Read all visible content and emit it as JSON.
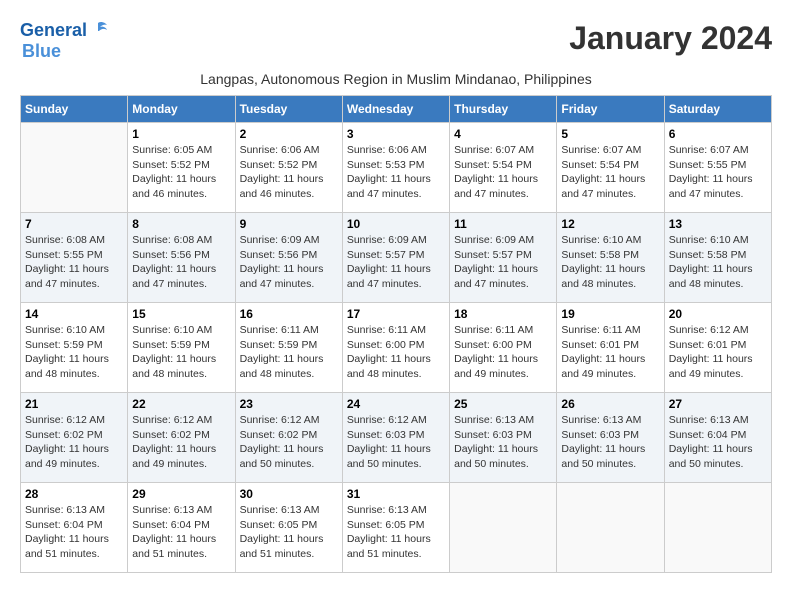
{
  "header": {
    "logo_line1": "General",
    "logo_line2": "Blue",
    "month_title": "January 2024",
    "subtitle": "Langpas, Autonomous Region in Muslim Mindanao, Philippines"
  },
  "days_of_week": [
    "Sunday",
    "Monday",
    "Tuesday",
    "Wednesday",
    "Thursday",
    "Friday",
    "Saturday"
  ],
  "weeks": [
    [
      {
        "day": "",
        "info": ""
      },
      {
        "day": "1",
        "info": "Sunrise: 6:05 AM\nSunset: 5:52 PM\nDaylight: 11 hours\nand 46 minutes."
      },
      {
        "day": "2",
        "info": "Sunrise: 6:06 AM\nSunset: 5:52 PM\nDaylight: 11 hours\nand 46 minutes."
      },
      {
        "day": "3",
        "info": "Sunrise: 6:06 AM\nSunset: 5:53 PM\nDaylight: 11 hours\nand 47 minutes."
      },
      {
        "day": "4",
        "info": "Sunrise: 6:07 AM\nSunset: 5:54 PM\nDaylight: 11 hours\nand 47 minutes."
      },
      {
        "day": "5",
        "info": "Sunrise: 6:07 AM\nSunset: 5:54 PM\nDaylight: 11 hours\nand 47 minutes."
      },
      {
        "day": "6",
        "info": "Sunrise: 6:07 AM\nSunset: 5:55 PM\nDaylight: 11 hours\nand 47 minutes."
      }
    ],
    [
      {
        "day": "7",
        "info": "Sunrise: 6:08 AM\nSunset: 5:55 PM\nDaylight: 11 hours\nand 47 minutes."
      },
      {
        "day": "8",
        "info": "Sunrise: 6:08 AM\nSunset: 5:56 PM\nDaylight: 11 hours\nand 47 minutes."
      },
      {
        "day": "9",
        "info": "Sunrise: 6:09 AM\nSunset: 5:56 PM\nDaylight: 11 hours\nand 47 minutes."
      },
      {
        "day": "10",
        "info": "Sunrise: 6:09 AM\nSunset: 5:57 PM\nDaylight: 11 hours\nand 47 minutes."
      },
      {
        "day": "11",
        "info": "Sunrise: 6:09 AM\nSunset: 5:57 PM\nDaylight: 11 hours\nand 47 minutes."
      },
      {
        "day": "12",
        "info": "Sunrise: 6:10 AM\nSunset: 5:58 PM\nDaylight: 11 hours\nand 48 minutes."
      },
      {
        "day": "13",
        "info": "Sunrise: 6:10 AM\nSunset: 5:58 PM\nDaylight: 11 hours\nand 48 minutes."
      }
    ],
    [
      {
        "day": "14",
        "info": "Sunrise: 6:10 AM\nSunset: 5:59 PM\nDaylight: 11 hours\nand 48 minutes."
      },
      {
        "day": "15",
        "info": "Sunrise: 6:10 AM\nSunset: 5:59 PM\nDaylight: 11 hours\nand 48 minutes."
      },
      {
        "day": "16",
        "info": "Sunrise: 6:11 AM\nSunset: 5:59 PM\nDaylight: 11 hours\nand 48 minutes."
      },
      {
        "day": "17",
        "info": "Sunrise: 6:11 AM\nSunset: 6:00 PM\nDaylight: 11 hours\nand 48 minutes."
      },
      {
        "day": "18",
        "info": "Sunrise: 6:11 AM\nSunset: 6:00 PM\nDaylight: 11 hours\nand 49 minutes."
      },
      {
        "day": "19",
        "info": "Sunrise: 6:11 AM\nSunset: 6:01 PM\nDaylight: 11 hours\nand 49 minutes."
      },
      {
        "day": "20",
        "info": "Sunrise: 6:12 AM\nSunset: 6:01 PM\nDaylight: 11 hours\nand 49 minutes."
      }
    ],
    [
      {
        "day": "21",
        "info": "Sunrise: 6:12 AM\nSunset: 6:02 PM\nDaylight: 11 hours\nand 49 minutes."
      },
      {
        "day": "22",
        "info": "Sunrise: 6:12 AM\nSunset: 6:02 PM\nDaylight: 11 hours\nand 49 minutes."
      },
      {
        "day": "23",
        "info": "Sunrise: 6:12 AM\nSunset: 6:02 PM\nDaylight: 11 hours\nand 50 minutes."
      },
      {
        "day": "24",
        "info": "Sunrise: 6:12 AM\nSunset: 6:03 PM\nDaylight: 11 hours\nand 50 minutes."
      },
      {
        "day": "25",
        "info": "Sunrise: 6:13 AM\nSunset: 6:03 PM\nDaylight: 11 hours\nand 50 minutes."
      },
      {
        "day": "26",
        "info": "Sunrise: 6:13 AM\nSunset: 6:03 PM\nDaylight: 11 hours\nand 50 minutes."
      },
      {
        "day": "27",
        "info": "Sunrise: 6:13 AM\nSunset: 6:04 PM\nDaylight: 11 hours\nand 50 minutes."
      }
    ],
    [
      {
        "day": "28",
        "info": "Sunrise: 6:13 AM\nSunset: 6:04 PM\nDaylight: 11 hours\nand 51 minutes."
      },
      {
        "day": "29",
        "info": "Sunrise: 6:13 AM\nSunset: 6:04 PM\nDaylight: 11 hours\nand 51 minutes."
      },
      {
        "day": "30",
        "info": "Sunrise: 6:13 AM\nSunset: 6:05 PM\nDaylight: 11 hours\nand 51 minutes."
      },
      {
        "day": "31",
        "info": "Sunrise: 6:13 AM\nSunset: 6:05 PM\nDaylight: 11 hours\nand 51 minutes."
      },
      {
        "day": "",
        "info": ""
      },
      {
        "day": "",
        "info": ""
      },
      {
        "day": "",
        "info": ""
      }
    ]
  ]
}
